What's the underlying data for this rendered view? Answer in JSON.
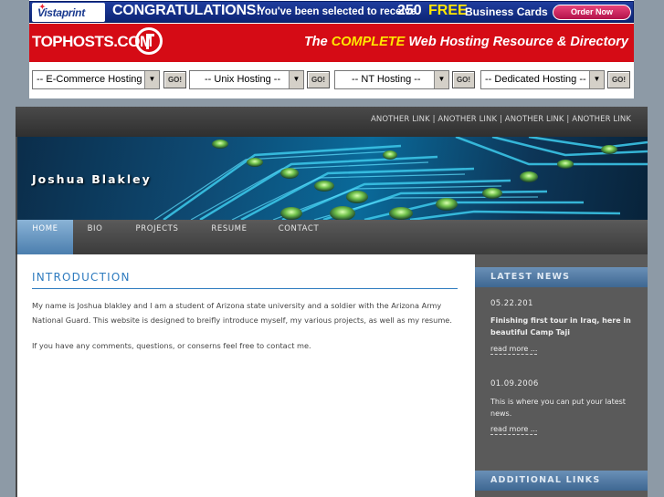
{
  "ad_vistaprint": {
    "logo": "Vistaprint",
    "congrats": "CONGRATULATIONS!",
    "selected_text": "You've been selected to receive",
    "number": "250",
    "free": "FREE",
    "cards": "Business Cards",
    "order_button": "Order Now"
  },
  "ad_tophosts": {
    "logo": "TOPHOSTS.COM",
    "tagline_the": "The",
    "tagline_complete": "COMPLETE",
    "tagline_rest": "Web Hosting Resource & Directory"
  },
  "hosting_selects": [
    {
      "value": "-- E-Commerce Hosting --",
      "go": "GO!"
    },
    {
      "value": "-- Unix Hosting --",
      "go": "GO!"
    },
    {
      "value": "-- NT Hosting --",
      "go": "GO!"
    },
    {
      "value": "-- Dedicated Hosting --",
      "go": "GO!"
    }
  ],
  "top_links": [
    "ANOTHER LINK",
    "ANOTHER LINK",
    "ANOTHER LINK",
    "ANOTHER LINK"
  ],
  "link_separator": "|",
  "site_name": "Joshua Blakley",
  "nav": [
    "HOME",
    "BIO",
    "PROJECTS",
    "RESUME",
    "CONTACT"
  ],
  "main": {
    "title": "INTRODUCTION",
    "paragraph1": "My name is Joshua blakley and I am a student of Arizona state university and a soldier with the Arizona Army National Guard. This website is designed to breifly introduce myself, my various projects, as well as my resume.",
    "paragraph2": "If you have any comments, questions, or conserns feel free to contact me."
  },
  "sidebar": {
    "latest_news_title": "LATEST NEWS",
    "news": [
      {
        "date": "05.22.201",
        "text": "Finishing first tour in Iraq, here in beautiful Camp Taji",
        "more": "read more ..."
      },
      {
        "date": "01.09.2006",
        "text": "This is where you can put your latest news.",
        "more": "read more ..."
      }
    ],
    "additional_links_title": "ADDITIONAL LINKS"
  },
  "colors": {
    "accent_blue": "#2e7bbf",
    "tophosts_red": "#d50b15",
    "vistaprint_blue": "#1f3d9e",
    "sidebar_gray": "#5a5a5a"
  }
}
